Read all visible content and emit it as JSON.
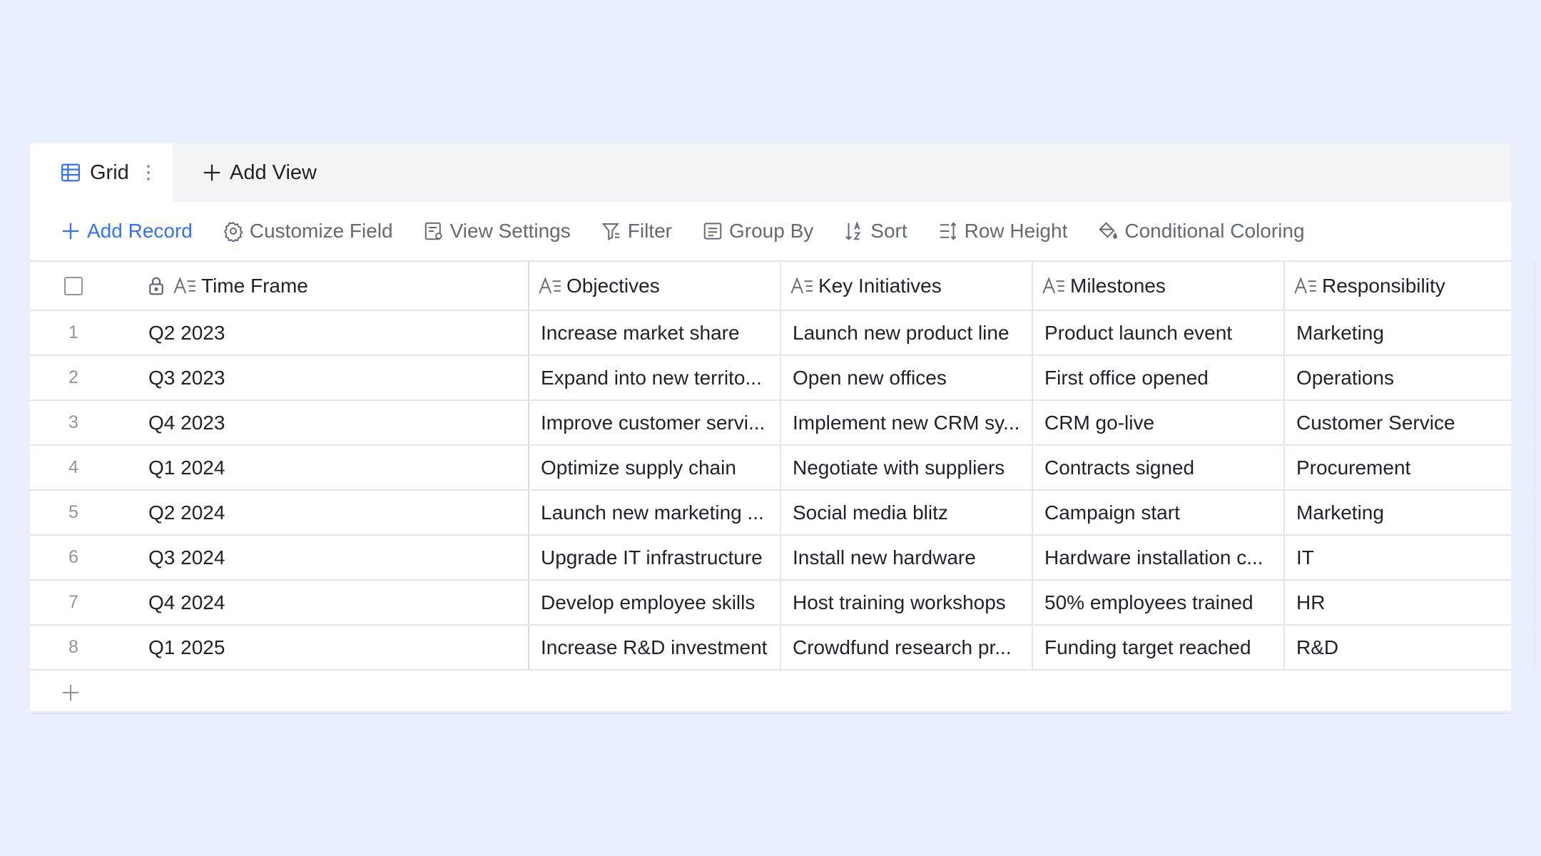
{
  "tabs": {
    "active": "Grid",
    "add_view": "Add View"
  },
  "toolbar": {
    "add_record": "Add Record",
    "customize_field": "Customize Field",
    "view_settings": "View Settings",
    "filter": "Filter",
    "group_by": "Group By",
    "sort": "Sort",
    "row_height": "Row Height",
    "conditional_coloring": "Conditional Coloring"
  },
  "colors": {
    "accent": "#3370ff",
    "background": "#e9effd"
  },
  "columns": [
    "Time Frame",
    "Objectives",
    "Key Initiatives",
    "Milestones",
    "Responsibility"
  ],
  "rows": [
    {
      "num": "1",
      "time_frame": "Q2 2023",
      "objectives": "Increase market share",
      "key_initiatives": "Launch new product line",
      "milestones": "Product launch event",
      "responsibility": "Marketing"
    },
    {
      "num": "2",
      "time_frame": "Q3 2023",
      "objectives": "Expand into new territo...",
      "key_initiatives": "Open new offices",
      "milestones": "First office opened",
      "responsibility": "Operations"
    },
    {
      "num": "3",
      "time_frame": "Q4 2023",
      "objectives": "Improve customer servi...",
      "key_initiatives": "Implement new CRM sy...",
      "milestones": "CRM go-live",
      "responsibility": "Customer Service"
    },
    {
      "num": "4",
      "time_frame": "Q1 2024",
      "objectives": "Optimize supply chain",
      "key_initiatives": "Negotiate with suppliers",
      "milestones": "Contracts signed",
      "responsibility": "Procurement"
    },
    {
      "num": "5",
      "time_frame": "Q2 2024",
      "objectives": "Launch new marketing ...",
      "key_initiatives": "Social media blitz",
      "milestones": "Campaign start",
      "responsibility": "Marketing"
    },
    {
      "num": "6",
      "time_frame": "Q3 2024",
      "objectives": "Upgrade IT infrastructure",
      "key_initiatives": "Install new hardware",
      "milestones": "Hardware installation c...",
      "responsibility": "IT"
    },
    {
      "num": "7",
      "time_frame": "Q4 2024",
      "objectives": "Develop employee skills",
      "key_initiatives": "Host training workshops",
      "milestones": "50% employees trained",
      "responsibility": "HR"
    },
    {
      "num": "8",
      "time_frame": "Q1 2025",
      "objectives": "Increase R&D investment",
      "key_initiatives": "Crowdfund research pr...",
      "milestones": "Funding target reached",
      "responsibility": "R&D"
    }
  ]
}
